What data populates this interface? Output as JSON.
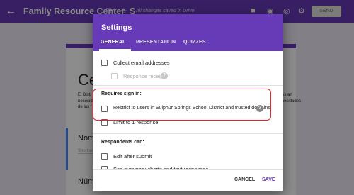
{
  "topbar": {
    "back_icon": "arrow-left-icon",
    "doc_title": "Family Resource Center_S",
    "saved_text": "All changes saved in Drive",
    "send_label": "SEND",
    "color": "#673ab7"
  },
  "form": {
    "big_title": "Cen",
    "desc_lines": [
      "El Distr",
      "necesid",
      "de las f"
    ],
    "right_snip_lines": [
      "es an",
      "cesidades"
    ],
    "q1_title": "Nomb",
    "q1_hint": "Short an",
    "q2_title": "Númer"
  },
  "dialog": {
    "title": "Settings",
    "tabs": [
      "GENERAL",
      "PRESENTATION",
      "QUIZZES"
    ],
    "active_tab": "GENERAL",
    "collect_email": "Collect email addresses",
    "response_receipts": "Response receipts",
    "requires_signin_label": "Requires sign in:",
    "restrict_users": "Restrict to users in Sulphur Springs School District and trusted domains",
    "limit_one": "Limit to 1 response",
    "respondents_can_label": "Respondents can:",
    "edit_after_submit": "Edit after submit",
    "see_summary": "See summary charts and text responses",
    "help_glyph": "?",
    "cancel_label": "CANCEL",
    "save_label": "SAVE",
    "highlight_color": "#e8232a"
  }
}
